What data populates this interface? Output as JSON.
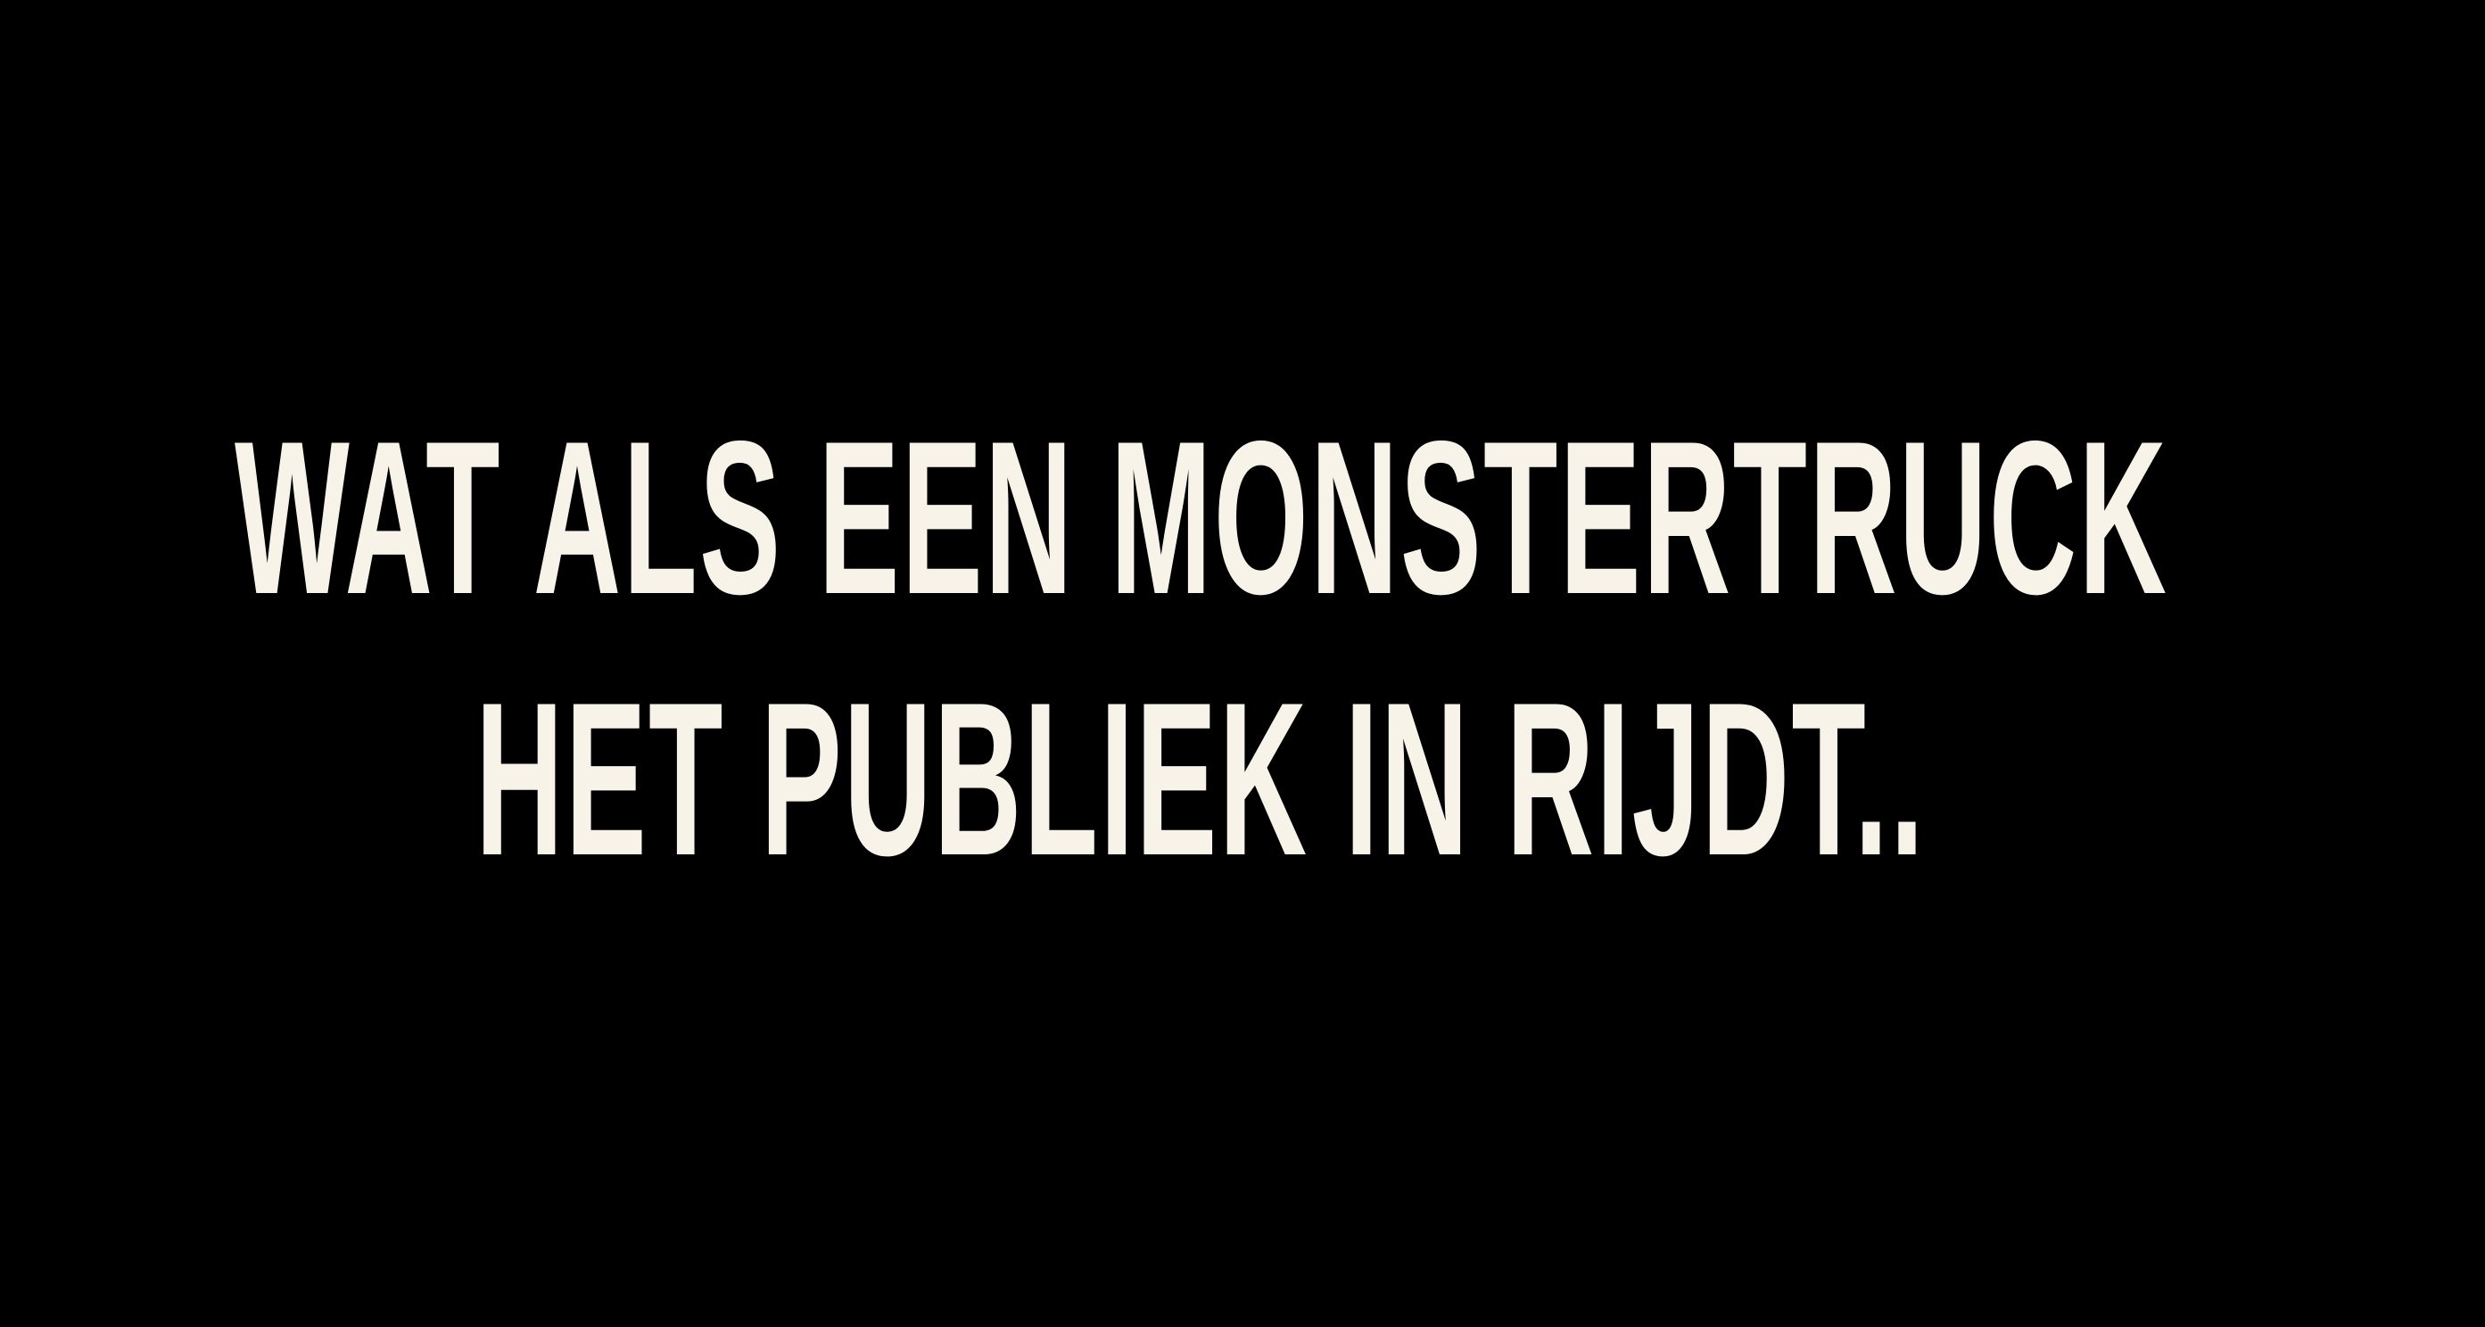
{
  "title": {
    "lines": [
      "WAT ALS EEN MONSTERTRUCK",
      "HET PUBLIEK IN RIJDT.."
    ]
  },
  "colors": {
    "background": "#000000",
    "text": "#f7f3e9"
  }
}
